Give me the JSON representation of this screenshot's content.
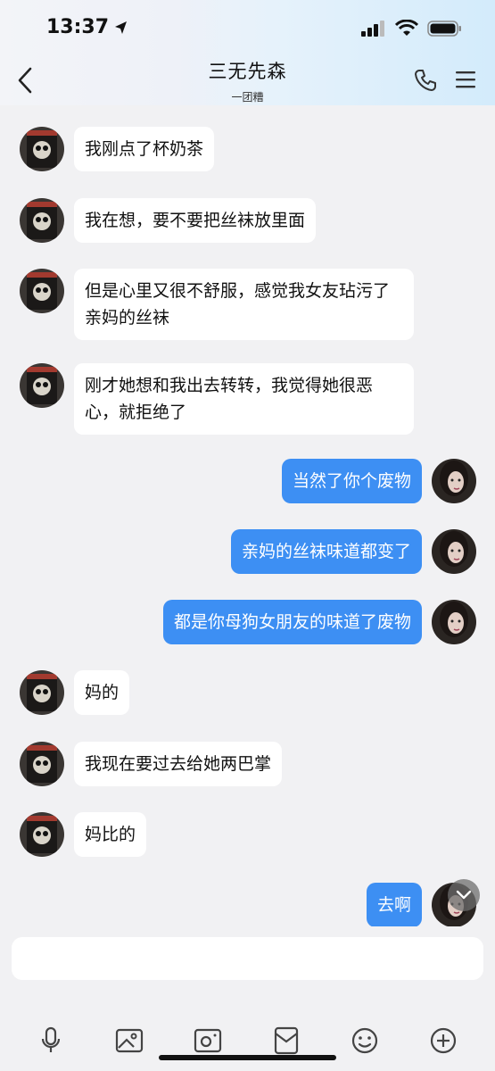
{
  "status_bar": {
    "time": "13:37"
  },
  "header": {
    "title": "三无先森",
    "subtitle": "一团糟"
  },
  "messages": [
    {
      "side": "left",
      "text": "我刚点了杯奶茶"
    },
    {
      "side": "left",
      "text": "我在想，要不要把丝袜放里面"
    },
    {
      "side": "left",
      "text": "但是心里又很不舒服，感觉我女友玷污了亲妈的丝袜"
    },
    {
      "side": "left",
      "text": "刚才她想和我出去转转，我觉得她很恶心，就拒绝了"
    },
    {
      "side": "right",
      "text": "当然了你个废物"
    },
    {
      "side": "right",
      "text": "亲妈的丝袜味道都变了"
    },
    {
      "side": "right",
      "text": "都是你母狗女朋友的味道了废物"
    },
    {
      "side": "left",
      "text": "妈的"
    },
    {
      "side": "left",
      "text": "我现在要过去给她两巴掌"
    },
    {
      "side": "left",
      "text": "妈比的"
    },
    {
      "side": "right",
      "text": "去啊"
    }
  ],
  "input": {
    "placeholder": ""
  },
  "toolbar": {
    "icons": [
      "microphone-icon",
      "image-icon",
      "camera-icon",
      "red-packet-icon",
      "emoji-icon",
      "plus-icon"
    ]
  },
  "colors": {
    "outgoing_bubble": "#3d8ff3",
    "incoming_bubble": "#ffffff",
    "background": "#f1f1f3"
  }
}
